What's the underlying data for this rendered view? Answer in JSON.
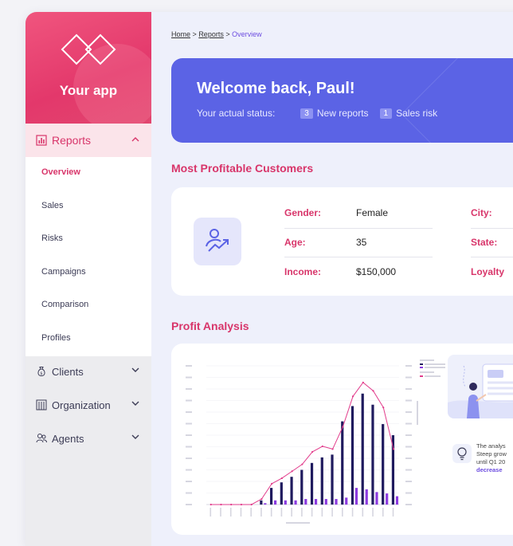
{
  "brand": {
    "name": "Your app"
  },
  "colors": {
    "accent": "#d8356a",
    "primary": "#5b63e5",
    "bar_dark": "#1f1a5e",
    "bar_light": "#8c3be0",
    "line": "#e23d8c"
  },
  "sidebar": {
    "reports": {
      "label": "Reports",
      "icon": "bar-chart-icon",
      "expanded": true
    },
    "subitems": [
      "Overview",
      "Sales",
      "Risks",
      "Campaigns",
      "Comparison",
      "Profiles"
    ],
    "active_subitem": "Overview",
    "items": [
      {
        "label": "Clients",
        "icon": "money-bag-icon"
      },
      {
        "label": "Organization",
        "icon": "building-icon"
      },
      {
        "label": "Agents",
        "icon": "people-icon"
      }
    ]
  },
  "breadcrumb": {
    "home": "Home",
    "reports": "Reports",
    "current": "Overview",
    "sep": ">"
  },
  "welcome": {
    "title": "Welcome back, Paul!",
    "status_label": "Your actual status:",
    "new_reports_count": "3",
    "new_reports_label": "New reports",
    "risks_count": "1",
    "risks_label": "Sales risk"
  },
  "customers": {
    "title": "Most Profitable Customers",
    "gender_label": "Gender:",
    "gender_value": "Female",
    "age_label": "Age:",
    "age_value": "35",
    "income_label": "Income:",
    "income_value": "$150,000",
    "city_label": "City:",
    "state_label": "State:",
    "loyalty_label": "Loyalty"
  },
  "profit": {
    "title": "Profit Analysis",
    "insight_line1": "The analys",
    "insight_line2": "Steep grow",
    "insight_line3": "until Q1 20",
    "insight_highlight": "decrease"
  },
  "chart_data": {
    "type": "bar",
    "series": [
      {
        "values": [
          0,
          0,
          0,
          0,
          0,
          3,
          12,
          16,
          20,
          25,
          30,
          34,
          36,
          60,
          71,
          80,
          72,
          58,
          50
        ]
      },
      {
        "values": [
          0,
          0,
          0,
          0,
          0,
          1,
          3,
          3,
          3,
          4,
          4,
          4,
          4,
          5,
          12,
          11,
          9,
          8,
          6
        ]
      },
      {
        "values": [
          0,
          0,
          0,
          0,
          0,
          4,
          15,
          19,
          24,
          29,
          38,
          42,
          40,
          56,
          78,
          88,
          82,
          70,
          40
        ]
      }
    ]
  }
}
